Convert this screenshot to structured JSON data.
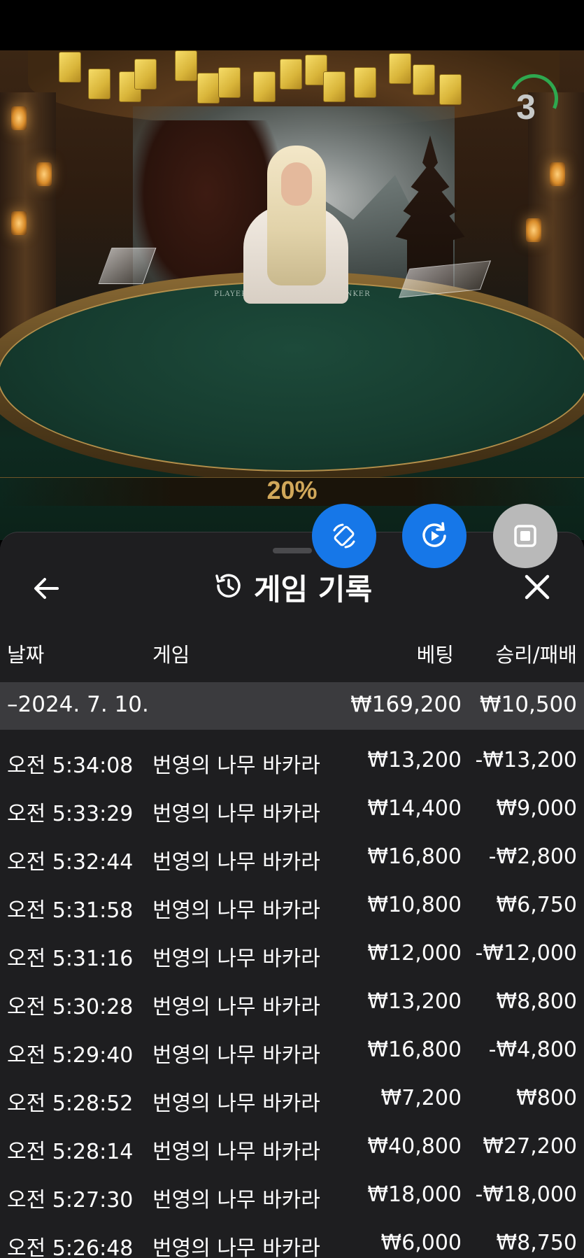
{
  "timer": {
    "value": "3"
  },
  "bonus_label": "20%",
  "table_labels": {
    "player": "PLAYER",
    "banker": "BANKER"
  },
  "fab": {
    "first_icon": "rotate-device-icon",
    "second_icon": "replay-icon",
    "third_icon": "stop-square-icon"
  },
  "panel": {
    "title": "게임 기록",
    "back_icon": "arrow-left-icon",
    "history_icon": "history-icon",
    "close_icon": "close-icon"
  },
  "columns": {
    "date": "날짜",
    "game": "게임",
    "bet": "베팅",
    "result": "승리/패배"
  },
  "day": {
    "date": "–2024. 7. 10.",
    "bet": "₩169,200",
    "result": "₩10,500"
  },
  "rows": [
    {
      "time": "오전 5:34:08",
      "game": "번영의 나무 바카라",
      "bet": "₩13,200",
      "result": "-₩13,200"
    },
    {
      "time": "오전 5:33:29",
      "game": "번영의 나무 바카라",
      "bet": "₩14,400",
      "result": "₩9,000"
    },
    {
      "time": "오전 5:32:44",
      "game": "번영의 나무 바카라",
      "bet": "₩16,800",
      "result": "-₩2,800"
    },
    {
      "time": "오전 5:31:58",
      "game": "번영의 나무 바카라",
      "bet": "₩10,800",
      "result": "₩6,750"
    },
    {
      "time": "오전 5:31:16",
      "game": "번영의 나무 바카라",
      "bet": "₩12,000",
      "result": "-₩12,000"
    },
    {
      "time": "오전 5:30:28",
      "game": "번영의 나무 바카라",
      "bet": "₩13,200",
      "result": "₩8,800"
    },
    {
      "time": "오전 5:29:40",
      "game": "번영의 나무 바카라",
      "bet": "₩16,800",
      "result": "-₩4,800"
    },
    {
      "time": "오전 5:28:52",
      "game": "번영의 나무 바카라",
      "bet": "₩7,200",
      "result": "₩800"
    },
    {
      "time": "오전 5:28:14",
      "game": "번영의 나무 바카라",
      "bet": "₩40,800",
      "result": "₩27,200"
    },
    {
      "time": "오전 5:27:30",
      "game": "번영의 나무 바카라",
      "bet": "₩18,000",
      "result": "-₩18,000"
    },
    {
      "time": "오전 5:26:48",
      "game": "번영의 나무 바카라",
      "bet": "₩6,000",
      "result": "₩8,750"
    }
  ]
}
